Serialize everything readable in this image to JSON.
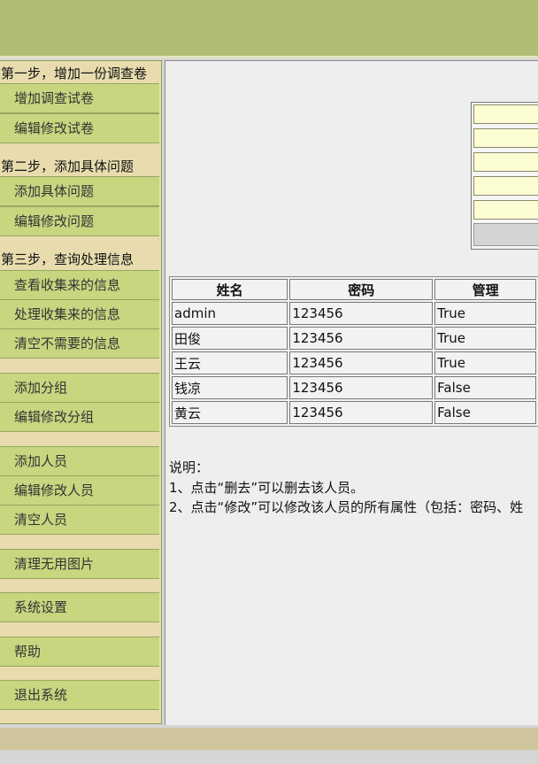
{
  "sidebar": {
    "step1": {
      "title": "第一步，增加一份调查卷",
      "items": [
        "增加调查试卷",
        "编辑修改试卷"
      ]
    },
    "step2": {
      "title": "第二步，添加具体问题",
      "items": [
        "添加具体问题",
        "编辑修改问题"
      ]
    },
    "step3": {
      "title": "第三步，查询处理信息",
      "items": [
        "查看收集来的信息",
        "处理收集来的信息",
        "清空不需要的信息"
      ]
    },
    "group_items": [
      "添加分组",
      "编辑修改分组"
    ],
    "people_items": [
      "添加人员",
      "编辑修改人员",
      "清空人员"
    ],
    "images_item": "清理无用图片",
    "settings_item": "系统设置",
    "help_item": "帮助",
    "logout_item": "退出系统"
  },
  "table": {
    "headers": [
      "姓名",
      "密码",
      "管理"
    ],
    "rows": [
      [
        "admin",
        "123456",
        "True"
      ],
      [
        "田俊",
        "123456",
        "True"
      ],
      [
        "王云",
        "123456",
        "True"
      ],
      [
        "钱凉",
        "123456",
        "False"
      ],
      [
        "黄云",
        "123456",
        "False"
      ]
    ]
  },
  "notes": {
    "heading": "说明：",
    "line1": "1、点击“删去”可以删去该人员。",
    "line2": "2、点击“修改”可以修改该人员的所有属性（包括：密码、姓"
  },
  "colors": {
    "header": "#afbd73",
    "nav_item": "#c7d67f",
    "sidebar_bg": "#e8dcae",
    "input_bg": "#fdfdd3"
  }
}
